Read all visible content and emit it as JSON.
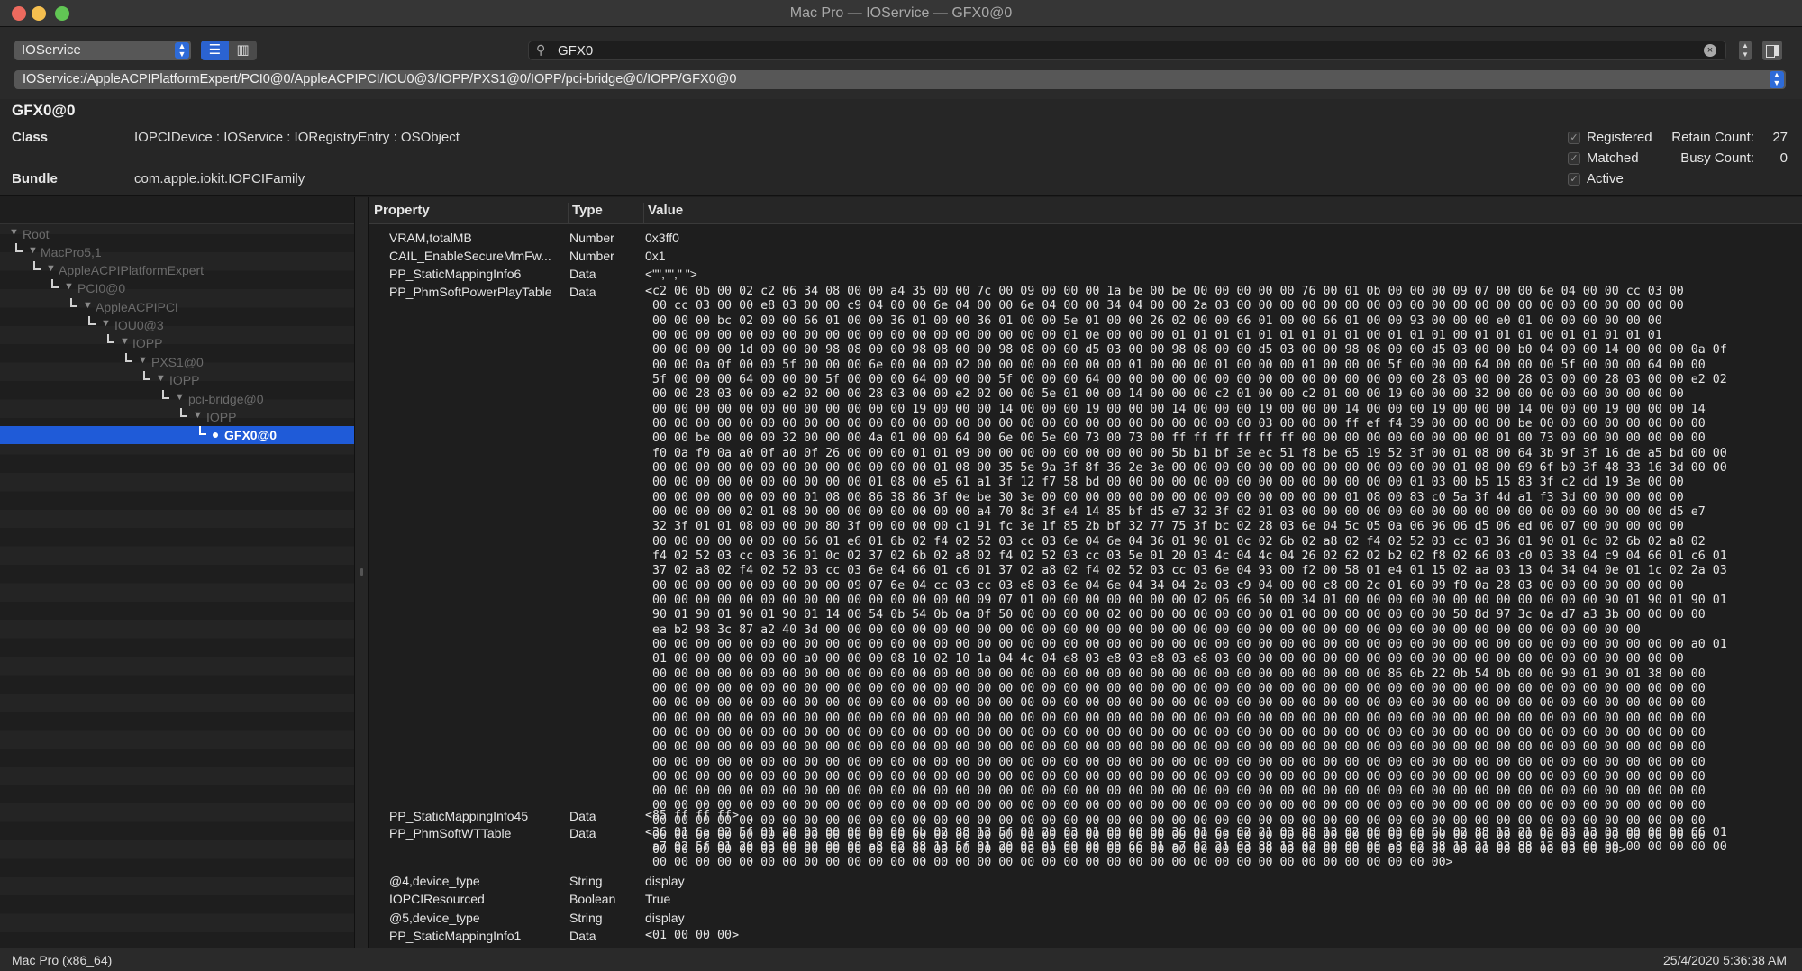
{
  "window": {
    "title": "Mac Pro — IOService — GFX0@0"
  },
  "toolbar": {
    "plane": "IOService",
    "search_value": "GFX0",
    "path": "IOService:/AppleACPIPlatformExpert/PCI0@0/AppleACPIPCI/IOU0@3/IOPP/PXS1@0/IOPP/pci-bridge@0/IOPP/GFX0@0"
  },
  "info": {
    "name": "GFX0@0",
    "class_label": "Class",
    "class_value": "IOPCIDevice : IOService : IORegistryEntry : OSObject",
    "bundle_label": "Bundle",
    "bundle_value": "com.apple.iokit.IOPCIFamily",
    "flags": [
      "Registered",
      "Matched",
      "Active"
    ],
    "retain_label": "Retain Count:",
    "retain_value": "27",
    "busy_label": "Busy Count:",
    "busy_value": "0"
  },
  "tree": {
    "nodes": [
      "Root",
      "MacPro5,1",
      "AppleACPIPlatformExpert",
      "PCI0@0",
      "AppleACPIPCI",
      "IOU0@3",
      "IOPP",
      "PXS1@0",
      "IOPP",
      "pci-bridge@0",
      "IOPP",
      "GFX0@0"
    ]
  },
  "table": {
    "headers": {
      "property": "Property",
      "type": "Type",
      "value": "Value"
    },
    "rows": [
      {
        "name": "VRAM,totalMB",
        "type": "Number",
        "value": "0x3ff0"
      },
      {
        "name": "CAIL_EnableSecureMmFw...",
        "type": "Number",
        "value": "0x1"
      },
      {
        "name": "PP_StaticMappingInfo6",
        "type": "Data",
        "value": "<\"\",\"\",\" \">"
      },
      {
        "name": "PP_PhmSoftPowerPlayTable",
        "type": "Data",
        "value": "<c2 06 0b 00 02 c2 06 34 08 00 00 a4 35 00 00 7c 00 09 00 00 00 1a be 00 be 00 00 00 00 00 76 00 01 0b 00 00 00 09 07 00 00 6e 04 00 00 cc 03 00\n 00 cc 03 00 00 e8 03 00 00 c9 04 00 00 6e 04 00 00 6e 04 00 00 34 04 00 00 2a 03 00 00 00 00 00 00 00 00 00 00 00 00 00 00 00 00 00 00 00 00 00\n 00 00 00 bc 02 00 00 66 01 00 00 36 01 00 00 36 01 00 00 5e 01 00 00 26 02 00 00 66 01 00 00 66 01 00 00 93 00 00 00 e0 01 00 00 00 00 00 00\n 00 00 00 00 00 00 00 00 00 00 00 00 00 00 00 00 00 00 00 01 0e 00 00 00 01 01 01 01 01 01 01 01 01 00 01 01 01 00 01 01 01 00 01 01 01 01 01\n 00 00 00 00 1d 00 00 00 98 08 00 00 98 08 00 00 98 08 00 00 d5 03 00 00 98 08 00 00 d5 03 00 00 98 08 00 00 d5 03 00 00 b0 04 00 00 14 00 00 00 0a 0f\n 00 00 0a 0f 00 00 5f 00 00 00 6e 00 00 00 02 00 00 00 00 00 00 00 01 00 00 00 01 00 00 00 01 00 00 00 5f 00 00 00 64 00 00 00 5f 00 00 00 64 00 00\n 5f 00 00 00 64 00 00 00 5f 00 00 00 64 00 00 00 5f 00 00 00 64 00 00 00 00 00 00 00 00 00 00 00 00 00 00 00 28 03 00 00 28 03 00 00 28 03 00 00 e2 02\n 00 00 28 03 00 00 e2 02 00 00 28 03 00 00 e2 02 00 00 5e 01 00 00 14 00 00 00 c2 01 00 00 c2 01 00 00 19 00 00 00 32 00 00 00 00 00 00 00 00 00\n 00 00 00 00 00 00 00 00 00 00 00 00 19 00 00 00 14 00 00 00 19 00 00 00 14 00 00 00 19 00 00 00 14 00 00 00 19 00 00 00 14 00 00 00 19 00 00 00 14\n 00 00 00 00 00 00 00 00 00 00 00 00 00 00 00 00 00 00 00 00 00 00 00 00 00 00 00 00 03 00 00 00 ff ef f4 39 00 00 00 00 be 00 00 00 00 00 00 00 00\n 00 00 be 00 00 00 32 00 00 00 4a 01 00 00 64 00 6e 00 5e 00 73 00 73 00 ff ff ff ff ff ff 00 00 00 00 00 00 00 00 00 01 00 73 00 00 00 00 00 00 00\n f0 0a f0 0a a0 0f a0 0f 26 00 00 00 01 01 09 00 00 00 00 00 00 00 00 00 5b b1 bf 3e ec 51 f8 be 65 19 52 3f 00 01 08 00 64 3b 9f 3f 16 de a5 bd 00 00\n 00 00 00 00 00 00 00 00 00 00 00 00 00 01 08 00 35 5e 9a 3f 8f 36 2e 3e 00 00 00 00 00 00 00 00 00 00 00 00 00 01 08 00 69 6f b0 3f 48 33 16 3d 00 00\n 00 00 00 00 00 00 00 00 00 00 01 08 00 e5 61 a1 3f 12 f7 58 bd 00 00 00 00 00 00 00 00 00 00 00 00 00 00 01 03 00 b5 15 83 3f c2 dd 19 3e 00 00\n 00 00 00 00 00 00 00 01 08 00 86 38 86 3f 0e be 30 3e 00 00 00 00 00 00 00 00 00 00 00 00 00 00 01 08 00 83 c0 5a 3f 4d a1 f3 3d 00 00 00 00 00\n 00 00 00 00 02 01 08 00 00 00 00 00 00 00 00 a4 70 8d 3f e4 14 85 bf d5 e7 32 3f 02 01 03 00 00 00 00 00 00 00 00 00 00 00 00 00 00 00 00 00 d5 e7\n 32 3f 01 01 08 00 00 00 80 3f 00 00 00 00 c1 91 fc 3e 1f 85 2b bf 32 77 75 3f bc 02 28 03 6e 04 5c 05 0a 06 96 06 d5 06 ed 06 07 00 00 00 00 00\n 00 00 00 00 00 00 00 66 01 e6 01 6b 02 f4 02 52 03 cc 03 6e 04 6e 04 36 01 90 01 0c 02 6b 02 a8 02 f4 02 52 03 cc 03 36 01 90 01 0c 02 6b 02 a8 02\n f4 02 52 03 cc 03 36 01 0c 02 37 02 6b 02 a8 02 f4 02 52 03 cc 03 5e 01 20 03 4c 04 4c 04 26 02 62 02 b2 02 f8 02 66 03 c0 03 38 04 c9 04 66 01 c6 01\n 37 02 a8 02 f4 02 52 03 cc 03 6e 04 66 01 c6 01 37 02 a8 02 f4 02 52 03 cc 03 6e 04 93 00 f2 00 58 01 e4 01 15 02 aa 03 13 04 34 04 0e 01 1c 02 2a 03\n 00 00 00 00 00 00 00 00 00 09 07 6e 04 cc 03 cc 03 e8 03 6e 04 6e 04 34 04 2a 03 c9 04 00 00 c8 00 2c 01 60 09 f0 0a 28 03 00 00 00 00 00 00 00\n 00 00 00 00 00 00 00 00 00 00 00 00 00 00 00 09 07 01 00 00 00 00 00 00 00 02 06 06 50 00 34 01 00 00 00 00 00 00 00 00 00 00 00 00 90 01 90 01 90 01\n 90 01 90 01 90 01 90 01 14 00 54 0b 54 0b 0a 0f 50 00 00 00 00 02 00 00 00 00 00 00 00 01 00 00 00 00 00 00 00 50 8d 97 3c 0a d7 a3 3b 00 00 00 00\n ea b2 98 3c 87 a2 40 3d 00 00 00 00 00 00 00 00 00 00 00 00 00 00 00 00 00 00 00 00 00 00 00 00 00 00 00 00 00 00 00 00 00 00 00 00 00 00\n 00 00 00 00 00 00 00 00 00 00 00 00 00 00 00 00 00 00 00 00 00 00 00 00 00 00 00 00 00 00 00 00 00 00 00 00 00 00 00 00 00 00 00 00 00 00 00 00 a0 01\n 01 00 00 00 00 00 00 a0 00 00 00 08 10 02 10 1a 04 4c 04 e8 03 e8 03 e8 03 e8 03 00 00 00 00 00 00 00 00 00 00 00 00 00 00 00 00 00 00 00 00 00\n 00 00 00 00 00 00 00 00 00 00 00 00 00 00 00 00 00 00 00 00 00 00 00 00 00 00 00 00 00 00 00 00 00 00 86 0b 22 0b 54 0b 00 00 90 01 90 01 38 00 00\n 00 00 00 00 00 00 00 00 00 00 00 00 00 00 00 00 00 00 00 00 00 00 00 00 00 00 00 00 00 00 00 00 00 00 00 00 00 00 00 00 00 00 00 00 00 00 00 00 00\n 00 00 00 00 00 00 00 00 00 00 00 00 00 00 00 00 00 00 00 00 00 00 00 00 00 00 00 00 00 00 00 00 00 00 00 00 00 00 00 00 00 00 00 00 00 00 00 00 00\n 00 00 00 00 00 00 00 00 00 00 00 00 00 00 00 00 00 00 00 00 00 00 00 00 00 00 00 00 00 00 00 00 00 00 00 00 00 00 00 00 00 00 00 00 00 00 00 00 00\n 00 00 00 00 00 00 00 00 00 00 00 00 00 00 00 00 00 00 00 00 00 00 00 00 00 00 00 00 00 00 00 00 00 00 00 00 00 00 00 00 00 00 00 00 00 00 00 00 00\n 00 00 00 00 00 00 00 00 00 00 00 00 00 00 00 00 00 00 00 00 00 00 00 00 00 00 00 00 00 00 00 00 00 00 00 00 00 00 00 00 00 00 00 00 00 00 00 00 00\n 00 00 00 00 00 00 00 00 00 00 00 00 00 00 00 00 00 00 00 00 00 00 00 00 00 00 00 00 00 00 00 00 00 00 00 00 00 00 00 00 00 00 00 00 00 00 00 00 00\n 00 00 00 00 00 00 00 00 00 00 00 00 00 00 00 00 00 00 00 00 00 00 00 00 00 00 00 00 00 00 00 00 00 00 00 00 00 00 00 00 00 00 00 00 00 00 00 00 00\n 00 00 00 00 00 00 00 00 00 00 00 00 00 00 00 00 00 00 00 00 00 00 00 00 00 00 00 00 00 00 00 00 00 00 00 00 00 00 00 00 00 00 00 00 00 00 00 00 00\n 00 00 00 00 00 00 00 00 00 00 00 00 00 00 00 00 00 00 00 00 00 00 00 00 00 00 00 00 00 00 00 00 00 00 00 00 00 00 00 00 00 00 00 00 00 00 00 00 00\n 00 00 00 00 00 00 00 00 00 00 00 00 00 00 00 00 00 00 00 00 00 00 00 00 00 00 00 00 00 00 00 00 00 00 00 00 00 00 00 00 00 00 00 00 00 00 00 00 00\n 00 00 00 00 00 00 00 00 00 00 00 00 00 00 00 00 00 00 00 00 00 00 00 00 00 00 00 00 00 00 00 00 00 00 00 00 00 00 00 00 00 00 00 00 00 00 00 00 00\n 00 00 00 00 00 00 00 00 00 00 00 00 00 00 00 00 00 00 00 00 00 00 00 00 00 00 00 00 00 00 00 00 00 00 00 00 00 00 00 00 00 00 00 00 00>"
      },
      {
        "name": "PP_StaticMappingInfo45",
        "type": "Data",
        "value": "<85 ff ff ff>"
      },
      {
        "name": "PP_PhmSoftWTTable",
        "type": "Data",
        "value": "<36 01 6a 02 5f 01 20 03 00 00 00 00 6b 02 88 13 5f 01 20 03 01 00 00 00 36 01 6a 02 21 03 88 13 02 00 00 00 6b 02 88 13 21 03 88 13 03 00 00 00 66 01\n a7 02 5f 01 20 03 00 00 00 00 a8 02 88 13 5f 01 20 03 01 00 00 00 66 01 a7 02 21 03 88 13 02 00 00 00 a8 02 88 13 21 03 88 13 03 00 00 00 00 00 00 00\n 00 00 00 00 00 00 00 00 00 00 00 00 00 00 00 00 00 00 00 00 00 00 00 00 00 00 00 00 00 00 00 00 00 00 00 00 00>"
      },
      {
        "name": "@4,device_type",
        "type": "String",
        "value": "display"
      },
      {
        "name": "IOPCIResourced",
        "type": "Boolean",
        "value": "True"
      },
      {
        "name": "@5,device_type",
        "type": "String",
        "value": "display"
      },
      {
        "name": "PP_StaticMappingInfo1",
        "type": "Data",
        "value": "<01 00 00 00>"
      }
    ]
  },
  "status": {
    "left": "Mac Pro (x86_64)",
    "right": "25/4/2020 5:36:38 AM"
  }
}
